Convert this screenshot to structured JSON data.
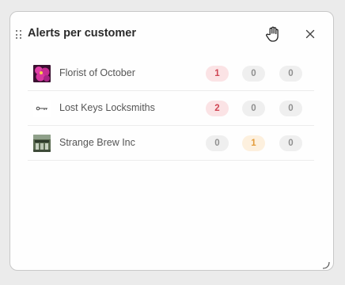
{
  "widget": {
    "title": "Alerts per customer",
    "icons": {
      "drag": "drag-handle-icon",
      "hand": "hand-cursor-icon",
      "close": "close-icon",
      "resize": "resize-handle-icon"
    }
  },
  "customers": [
    {
      "name": "Florist of October",
      "thumbnail": "pink-flower-image",
      "alerts": [
        {
          "value": "1",
          "status": "red"
        },
        {
          "value": "0",
          "status": "gray"
        },
        {
          "value": "0",
          "status": "gray"
        }
      ]
    },
    {
      "name": "Lost Keys Locksmiths",
      "thumbnail": "key-image",
      "alerts": [
        {
          "value": "2",
          "status": "red"
        },
        {
          "value": "0",
          "status": "gray"
        },
        {
          "value": "0",
          "status": "gray"
        }
      ]
    },
    {
      "name": "Strange Brew Inc",
      "thumbnail": "storefront-image",
      "alerts": [
        {
          "value": "0",
          "status": "gray"
        },
        {
          "value": "1",
          "status": "orange"
        },
        {
          "value": "0",
          "status": "gray"
        }
      ]
    }
  ],
  "colors": {
    "red_bg": "#fbe3e5",
    "red_text": "#cf4654",
    "orange_bg": "#fdf0de",
    "orange_text": "#e39c3b",
    "gray_bg": "#efefef",
    "gray_text": "#8f8f8f"
  }
}
